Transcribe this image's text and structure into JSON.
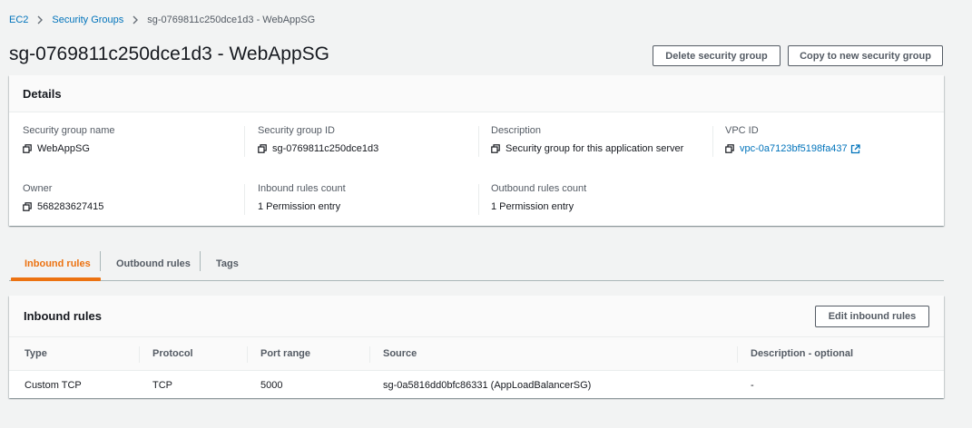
{
  "breadcrumb": {
    "items": [
      "EC2",
      "Security Groups"
    ],
    "current": "sg-0769811c250dce1d3 - WebAppSG"
  },
  "page_title": "sg-0769811c250dce1d3 - WebAppSG",
  "actions": {
    "delete_label": "Delete security group",
    "copy_label": "Copy to new security group"
  },
  "details": {
    "title": "Details",
    "fields": {
      "sg_name": {
        "label": "Security group name",
        "value": "WebAppSG"
      },
      "sg_id": {
        "label": "Security group ID",
        "value": "sg-0769811c250dce1d3"
      },
      "description": {
        "label": "Description",
        "value": "Security group for this application server"
      },
      "vpc_id": {
        "label": "VPC ID",
        "value": "vpc-0a7123bf5198fa437"
      },
      "owner": {
        "label": "Owner",
        "value": "568283627415"
      },
      "inbound_count": {
        "label": "Inbound rules count",
        "value": "1 Permission entry"
      },
      "outbound_count": {
        "label": "Outbound rules count",
        "value": "1 Permission entry"
      }
    }
  },
  "tabs": [
    "Inbound rules",
    "Outbound rules",
    "Tags"
  ],
  "inbound": {
    "title": "Inbound rules",
    "edit_label": "Edit inbound rules",
    "columns": [
      "Type",
      "Protocol",
      "Port range",
      "Source",
      "Description - optional"
    ],
    "rows": [
      [
        "Custom TCP",
        "TCP",
        "5000",
        "sg-0a5816dd0bfc86331 (AppLoadBalancerSG)",
        "-"
      ]
    ]
  },
  "colors": {
    "link": "#0073bb",
    "active_tab": "#ec7211",
    "background": "#f2f3f3"
  }
}
